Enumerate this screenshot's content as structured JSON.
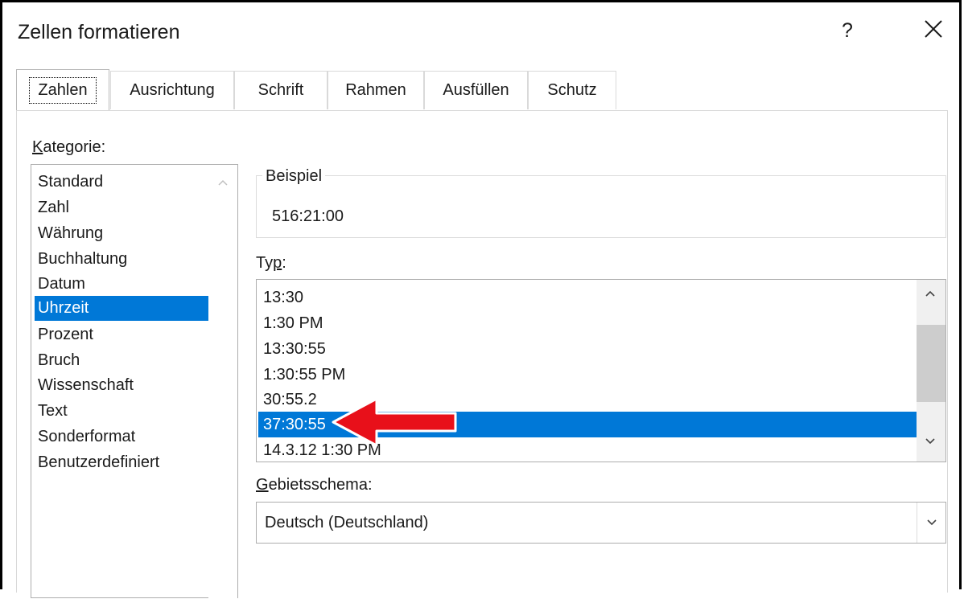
{
  "window": {
    "title": "Zellen formatieren",
    "help": "?"
  },
  "tabs": [
    "Zahlen",
    "Ausrichtung",
    "Schrift",
    "Rahmen",
    "Ausfüllen",
    "Schutz"
  ],
  "kategorie": {
    "label": "Kategorie:",
    "underline": "K",
    "items": [
      "Standard",
      "Zahl",
      "Währung",
      "Buchhaltung",
      "Datum",
      "Uhrzeit",
      "Prozent",
      "Bruch",
      "Wissenschaft",
      "Text",
      "Sonderformat",
      "Benutzerdefiniert"
    ],
    "selected": "Uhrzeit"
  },
  "beispiel": {
    "label": "Beispiel",
    "value": "516:21:00"
  },
  "typ": {
    "label": "Typ:",
    "items": [
      "13:30",
      "1:30 PM",
      "13:30:55",
      "1:30:55 PM",
      "30:55.2",
      "37:30:55",
      "14.3.12 1:30 PM"
    ],
    "selected": "37:30:55"
  },
  "gebietsschema": {
    "label": "Gebietsschema:",
    "value": "Deutsch (Deutschland)"
  },
  "colors": {
    "selection": "#0078d7",
    "annotation_arrow": "#e8101a"
  },
  "icons": {
    "close": "close-icon",
    "help": "help-icon",
    "scroll_up": "chevron-up-icon",
    "scroll_down": "chevron-down-icon",
    "combo": "chevron-down-icon",
    "annotation": "red-arrow-icon"
  }
}
